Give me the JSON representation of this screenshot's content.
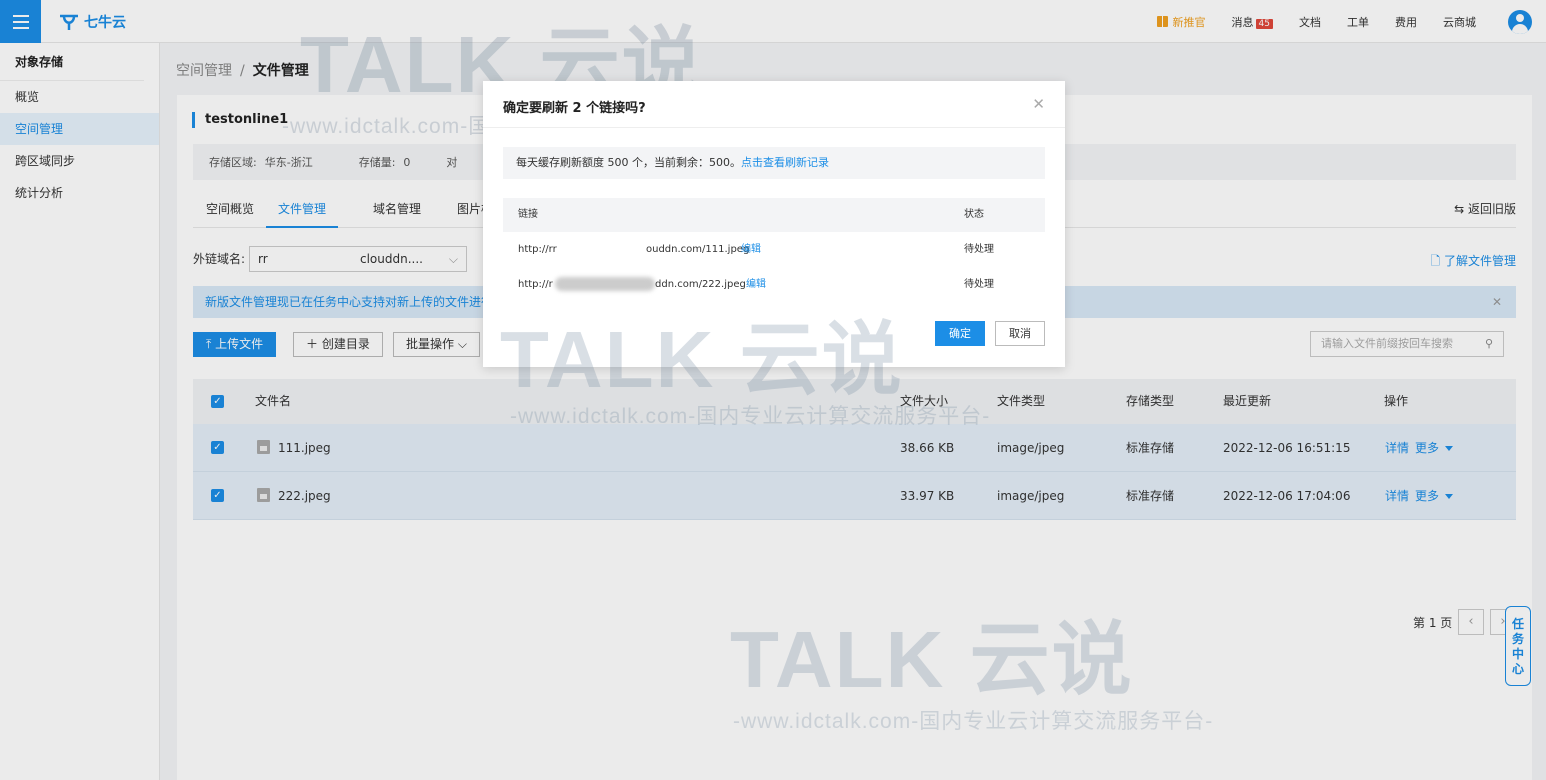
{
  "topbar": {
    "logo": "七牛云",
    "nav": {
      "new_officer": "新推官",
      "messages": "消息",
      "messages_count": "45",
      "docs": "文档",
      "tickets": "工单",
      "billing": "费用",
      "marketplace": "云商城"
    }
  },
  "sidebar": {
    "title": "对象存储",
    "items": [
      {
        "label": "概览"
      },
      {
        "label": "空间管理"
      },
      {
        "label": "跨区域同步"
      },
      {
        "label": "统计分析"
      }
    ]
  },
  "breadcrumb": {
    "parent": "空间管理",
    "separator": "/",
    "current": "文件管理"
  },
  "bucket": {
    "name": "testonline1",
    "region_label": "存储区域:",
    "region_value": "华东-浙江",
    "storage_label": "存储量:",
    "storage_value": "0",
    "truncated": "对"
  },
  "tabs": [
    {
      "label": "空间概览"
    },
    {
      "label": "文件管理"
    },
    {
      "label": "域名管理"
    },
    {
      "label": "图片样"
    }
  ],
  "back_old": "返回旧版",
  "domain": {
    "label": "外链域名:",
    "value_prefix": "rr",
    "value_suffix": "clouddn...."
  },
  "learn_link": "了解文件管理",
  "notice": "新版文件管理现已在任务中心支持对新上传的文件进行复",
  "toolbar": {
    "upload": "上传文件",
    "create_dir": "创建目录",
    "batch": "批量操作"
  },
  "search": {
    "placeholder": "请输入文件前缀按回车搜索"
  },
  "table": {
    "headers": [
      "文件名",
      "文件大小",
      "文件类型",
      "存储类型",
      "最近更新",
      "操作"
    ],
    "rows": [
      {
        "name": "111.jpeg",
        "size": "38.66 KB",
        "type": "image/jpeg",
        "storage": "标准存储",
        "updated": "2022-12-06 16:51:15",
        "detail": "详情",
        "more": "更多"
      },
      {
        "name": "222.jpeg",
        "size": "33.97 KB",
        "type": "image/jpeg",
        "storage": "标准存储",
        "updated": "2022-12-06 17:04:06",
        "detail": "详情",
        "more": "更多"
      }
    ]
  },
  "pager": {
    "label": "第 1 页"
  },
  "task_center": "任务中心",
  "modal": {
    "title": "确定要刷新 2 个链接吗?",
    "quota_text": "每天缓存刷新额度 500 个，当前剩余：500。",
    "quota_link": "点击查看刷新记录",
    "col_link": "链接",
    "col_status": "状态",
    "rows": [
      {
        "url_start": "http://rr",
        "url_end": "ouddn.com/111.jpeg",
        "edit": "编辑",
        "status": "待处理"
      },
      {
        "url_start": "http://r",
        "url_end": "ddn.com/222.jpeg",
        "edit": "编辑",
        "status": "待处理"
      }
    ],
    "ok": "确定",
    "cancel": "取消"
  },
  "watermark": {
    "brand": "TALK 云说",
    "slogan": "-www.idctalk.com-国内专业云计算交流服务平台-"
  }
}
